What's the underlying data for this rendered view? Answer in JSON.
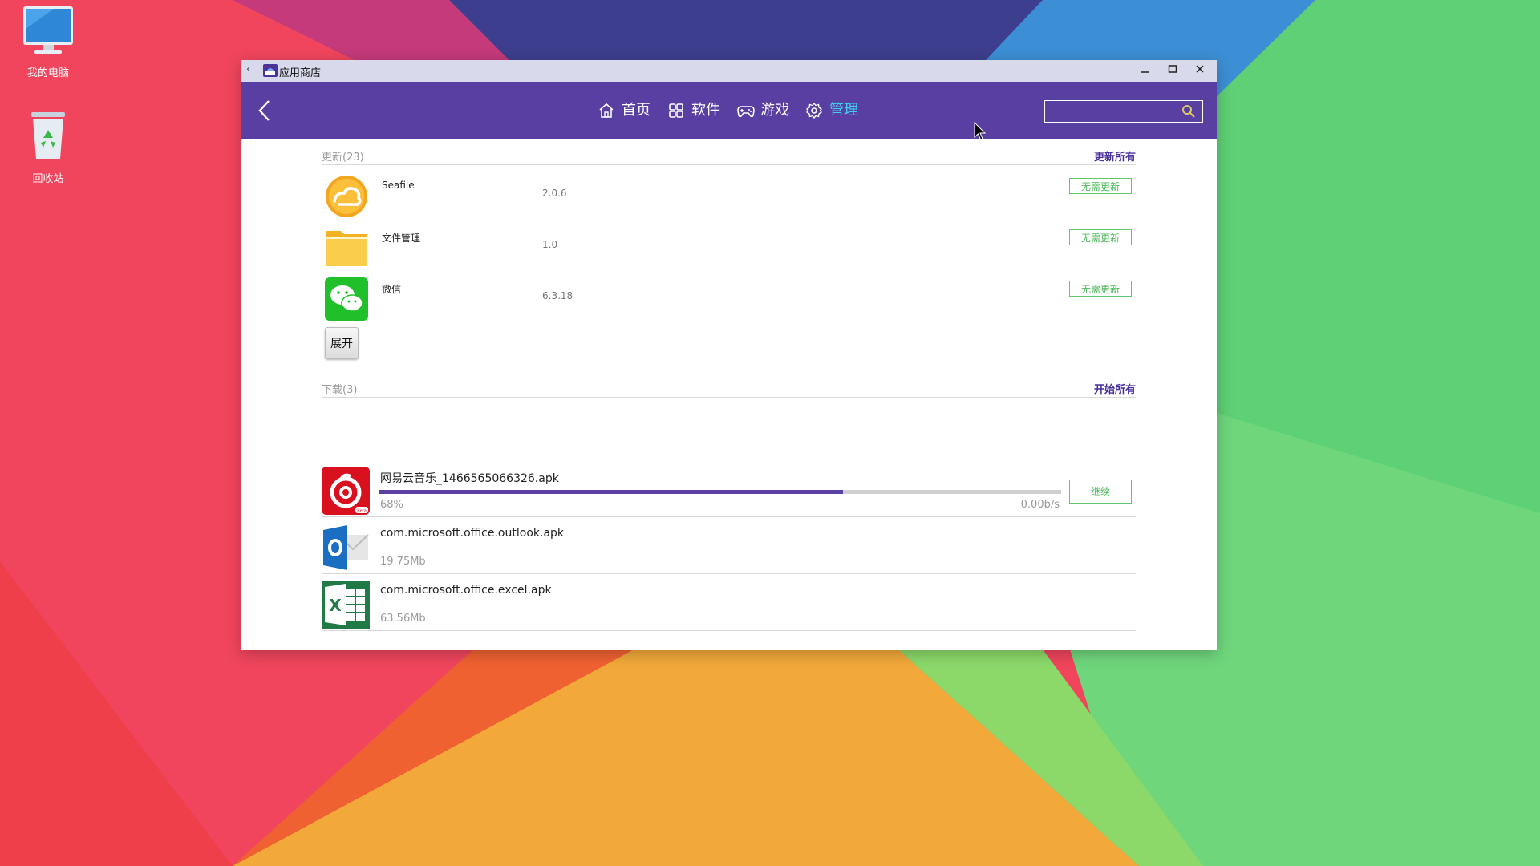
{
  "colors": {
    "accent": "#5a3fa3",
    "active_nav": "#3fd0f0",
    "update_button": "#4cb85a",
    "progress_fill": "#5a3fa3"
  },
  "desktop": {
    "icons": [
      {
        "label": "我的电脑",
        "icon": "computer-icon"
      },
      {
        "label": "回收站",
        "icon": "recycle-bin-icon"
      }
    ]
  },
  "window": {
    "title": "应用商店",
    "controls": [
      "minimize-icon",
      "maximize-icon",
      "close-icon"
    ]
  },
  "nav": {
    "items": [
      {
        "label": "首页",
        "icon": "home-icon",
        "active": false
      },
      {
        "label": "软件",
        "icon": "grid-icon",
        "active": false
      },
      {
        "label": "游戏",
        "icon": "gamepad-icon",
        "active": false
      },
      {
        "label": "管理",
        "icon": "gear-icon",
        "active": true
      }
    ],
    "search": {
      "placeholder": "",
      "icon": "search-icon"
    }
  },
  "updates": {
    "title": "更新(23)",
    "action": "更新所有",
    "items": [
      {
        "name": "Seafile",
        "version": "2.0.6",
        "button": "无需更新",
        "icon": "seafile-icon"
      },
      {
        "name": "文件管理",
        "version": "1.0",
        "button": "无需更新",
        "icon": "folder-icon"
      },
      {
        "name": "微信",
        "version": "6.3.18",
        "button": "无需更新",
        "icon": "wechat-icon"
      }
    ],
    "expand_label": "展开"
  },
  "downloads": {
    "title": "下载(3)",
    "action": "开始所有",
    "items": [
      {
        "name": "网易云音乐_1466565066326.apk",
        "sub": "68%",
        "speed": "0.00b/s",
        "progress": 0.68,
        "button": "继续",
        "icon": "netease-music-icon"
      },
      {
        "name": "com.microsoft.office.outlook.apk",
        "sub": "19.75Mb",
        "icon": "outlook-icon"
      },
      {
        "name": "com.microsoft.office.excel.apk",
        "sub": "63.56Mb",
        "icon": "excel-icon"
      }
    ]
  }
}
